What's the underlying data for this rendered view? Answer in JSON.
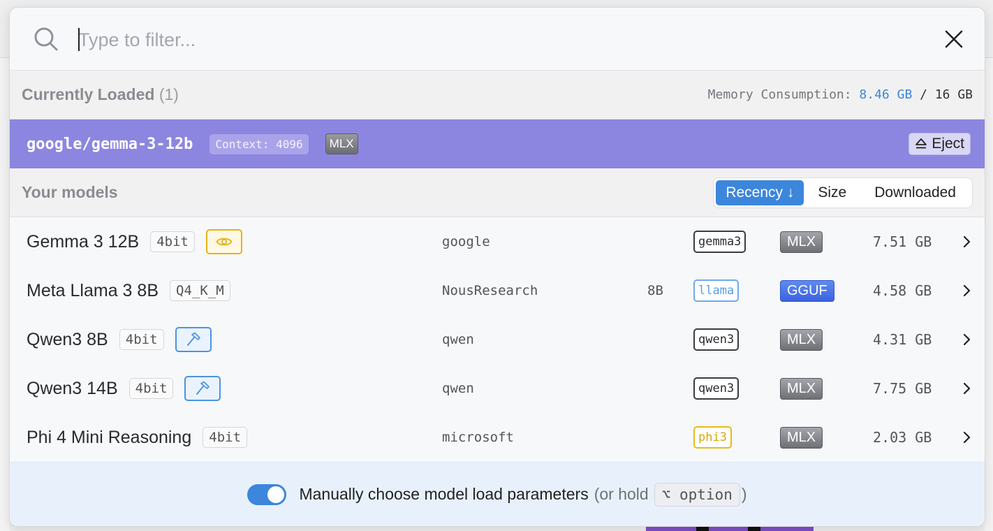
{
  "search": {
    "placeholder": "Type to filter..."
  },
  "loaded": {
    "title": "Currently Loaded",
    "count": "(1)",
    "memory_label": "Memory Consumption:",
    "memory_used": "8.46 GB",
    "memory_sep": "/",
    "memory_total": "16 GB",
    "model": "google/gemma-3-12b",
    "context": "Context: 4096",
    "format": "MLX",
    "eject_label": "Eject"
  },
  "models": {
    "title": "Your models",
    "sort": {
      "recency": "Recency ↓",
      "size": "Size",
      "downloaded": "Downloaded"
    },
    "rows": [
      {
        "name": "Gemma 3 12B",
        "quant": "4bit",
        "capability": "vision",
        "publisher": "google",
        "params": "",
        "arch": "gemma3",
        "arch_style": "dark",
        "format": "MLX",
        "size": "7.51 GB"
      },
      {
        "name": "Meta Llama 3 8B",
        "quant": "Q4_K_M",
        "capability": "",
        "publisher": "NousResearch",
        "params": "8B",
        "arch": "llama",
        "arch_style": "blue",
        "format": "GGUF",
        "size": "4.58 GB"
      },
      {
        "name": "Qwen3 8B",
        "quant": "4bit",
        "capability": "tool-use",
        "publisher": "qwen",
        "params": "",
        "arch": "qwen3",
        "arch_style": "dark",
        "format": "MLX",
        "size": "4.31 GB"
      },
      {
        "name": "Qwen3 14B",
        "quant": "4bit",
        "capability": "tool-use",
        "publisher": "qwen",
        "params": "",
        "arch": "qwen3",
        "arch_style": "dark",
        "format": "MLX",
        "size": "7.75 GB"
      },
      {
        "name": "Phi 4 Mini Reasoning",
        "quant": "4bit",
        "capability": "",
        "publisher": "microsoft",
        "params": "",
        "arch": "phi3",
        "arch_style": "yellow",
        "format": "MLX",
        "size": "2.03 GB"
      }
    ]
  },
  "footer": {
    "label": "Manually choose model load parameters",
    "hint_prefix": "(or hold",
    "key": "⌥ option",
    "hint_suffix": ")",
    "toggle_on": true
  },
  "colors": {
    "accent": "#3c86dc",
    "loaded_row": "#8c86e0",
    "vision": "#e3b41b",
    "tool": "#4c93e0"
  },
  "icons": {
    "search": "search-icon",
    "close": "close-icon",
    "eject": "eject-icon",
    "vision": "eye-icon",
    "tool": "hammer-icon",
    "chevron": "chevron-right-icon"
  }
}
